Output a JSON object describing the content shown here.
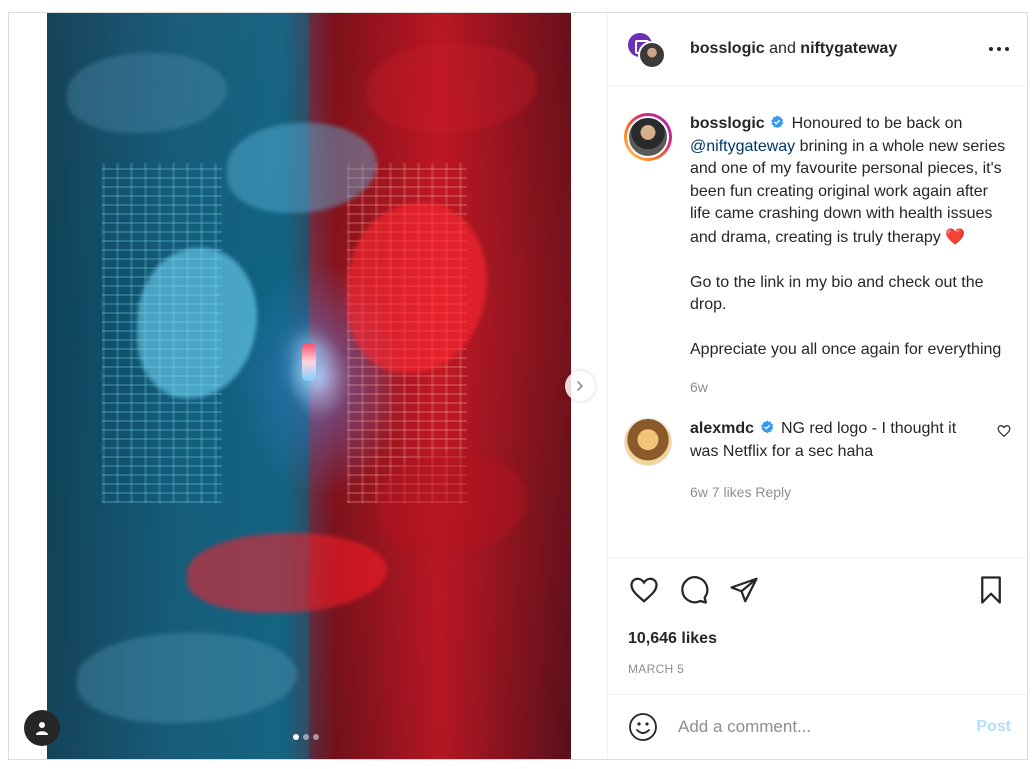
{
  "header": {
    "author": "bosslogic",
    "connector": "and",
    "collaborator": "niftygateway"
  },
  "caption": {
    "username": "bosslogic",
    "lead": "Honoured to be back on",
    "mention": "@niftygateway",
    "rest": "brining in a whole new series and one of my favourite personal pieces, it's been fun creating original work again after life came crashing down with health issues and drama, creating is truly therapy",
    "emoji": "❤️",
    "paragraph2": "Go to the link in my bio and check out the drop.",
    "paragraph3": "Appreciate you all once again for everything",
    "time": "6w"
  },
  "comment": {
    "username": "alexmdc",
    "text": "NG red logo - I thought it was Netflix for a sec haha",
    "meta": "6w   7 likes   Reply"
  },
  "engagement": {
    "likes": "10,646 likes",
    "date": "MARCH 5"
  },
  "add_comment": {
    "placeholder": "Add a comment...",
    "post_label": "Post"
  },
  "carousel": {
    "slides": 3,
    "active": 1
  },
  "colors": {
    "accent": "#0095f6",
    "post_disabled": "#b2dffc",
    "verified": "#3897f0",
    "like_red": "#ed4956"
  },
  "icons": [
    "person-icon",
    "chevron-right-icon",
    "more-icon",
    "verified-icon",
    "heart-icon",
    "comment-icon",
    "share-icon",
    "bookmark-icon",
    "emoji-icon"
  ]
}
